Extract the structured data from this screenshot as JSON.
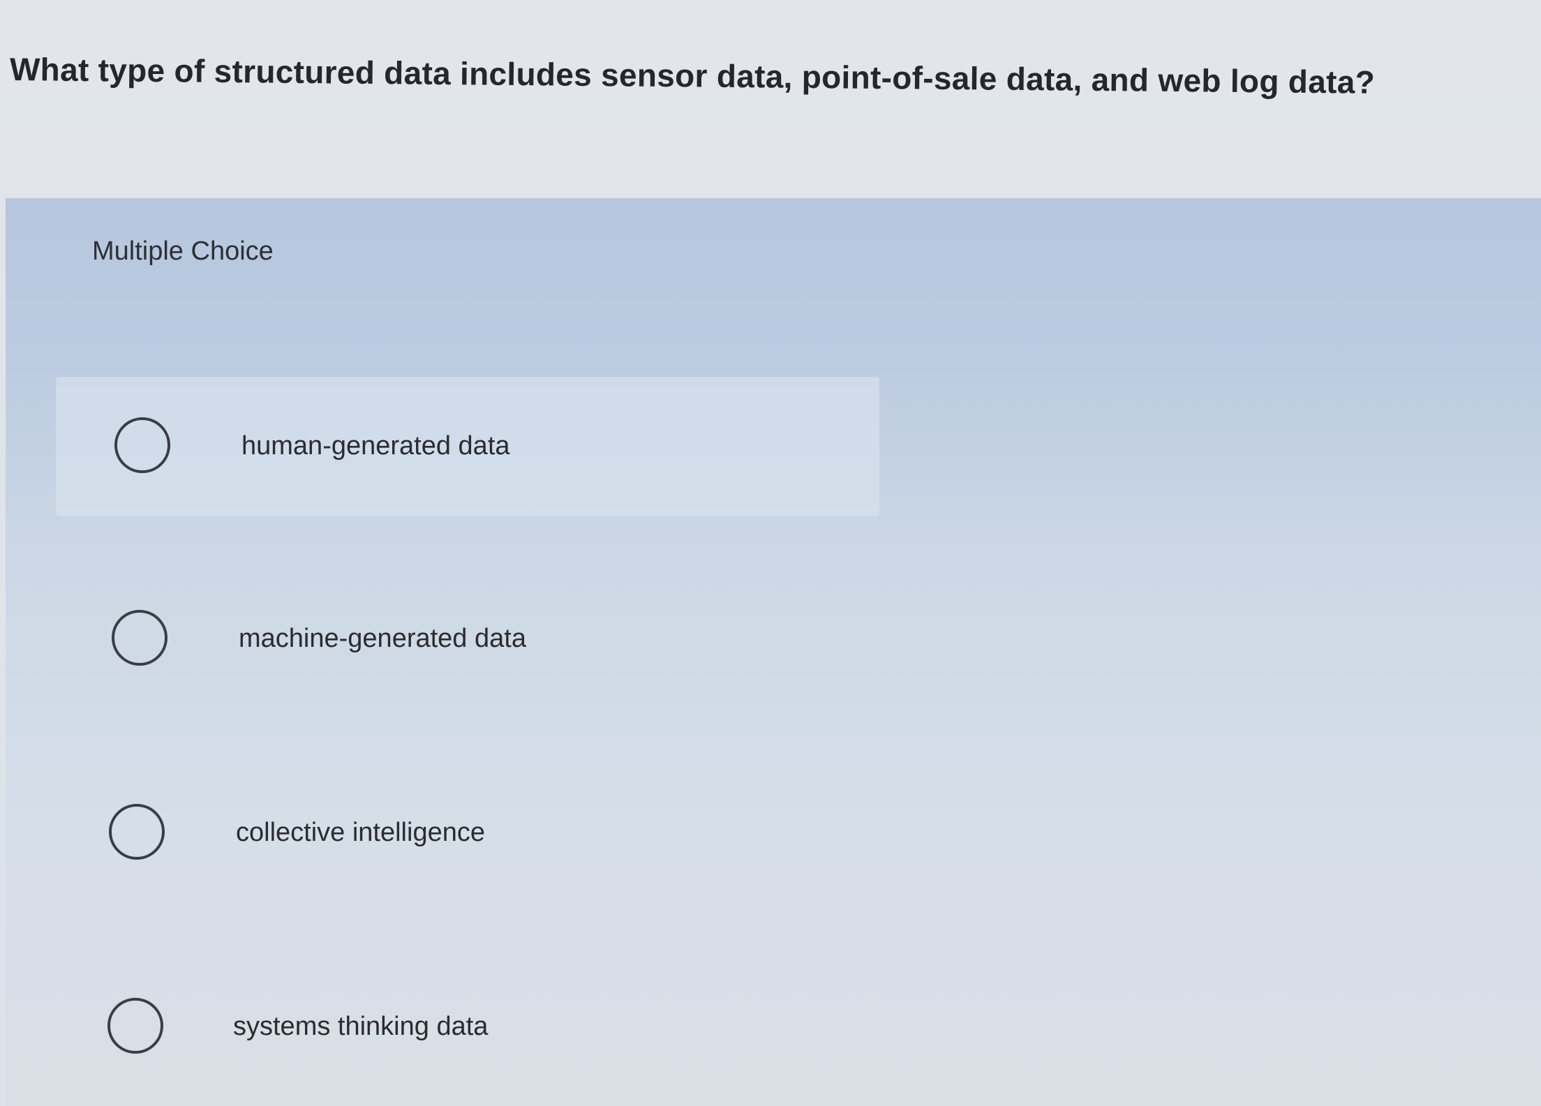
{
  "question": {
    "text": "What type of structured data includes sensor data, point-of-sale data, and web log data?"
  },
  "question_type_label": "Multiple Choice",
  "options": [
    {
      "label": "human-generated data",
      "selected": false
    },
    {
      "label": "machine-generated data",
      "selected": false
    },
    {
      "label": "collective intelligence",
      "selected": false
    },
    {
      "label": "systems thinking data",
      "selected": false
    }
  ],
  "colors": {
    "page_background": "#e0e5eb",
    "panel_background": "#bccbe0",
    "text": "#2a2c31",
    "radio_border": "#3a3d44"
  },
  "icons": {
    "radio": "radio-unselected-icon"
  }
}
